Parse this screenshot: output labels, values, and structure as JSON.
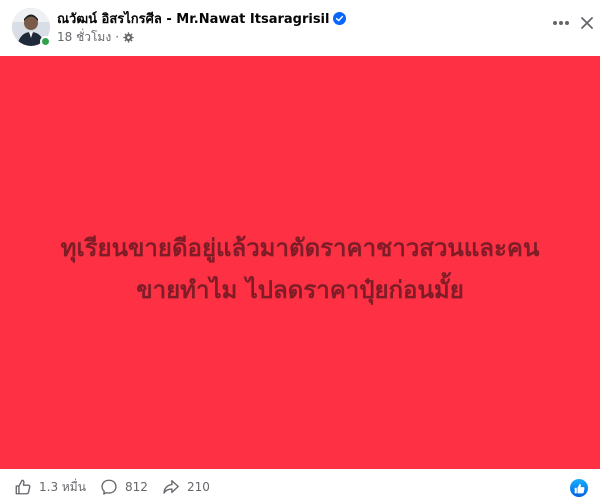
{
  "post": {
    "author_name": "ณวัฒน์ อิสรไกรศีล - Mr.Nawat Itsaragrisil",
    "timestamp": "18 ชั่วโมง",
    "separator": "·",
    "privacy_icon": "settings-gear-icon",
    "verified_icon": "verified-badge-icon",
    "text": "ทุเรียนขายดีอยู่แล้วมาตัดราคาชาวสวนและคน\nขายทำไม ไปลดราคาปุ๋ยก่อนมั้ย",
    "background_color": "#fe3043",
    "text_color": "#7e1d28"
  },
  "footer": {
    "likes": "1.3 หมื่น",
    "comments": "812",
    "shares": "210"
  },
  "colors": {
    "online": "#31a24c",
    "verified": "#0866ff",
    "muted_text": "#65676b"
  }
}
